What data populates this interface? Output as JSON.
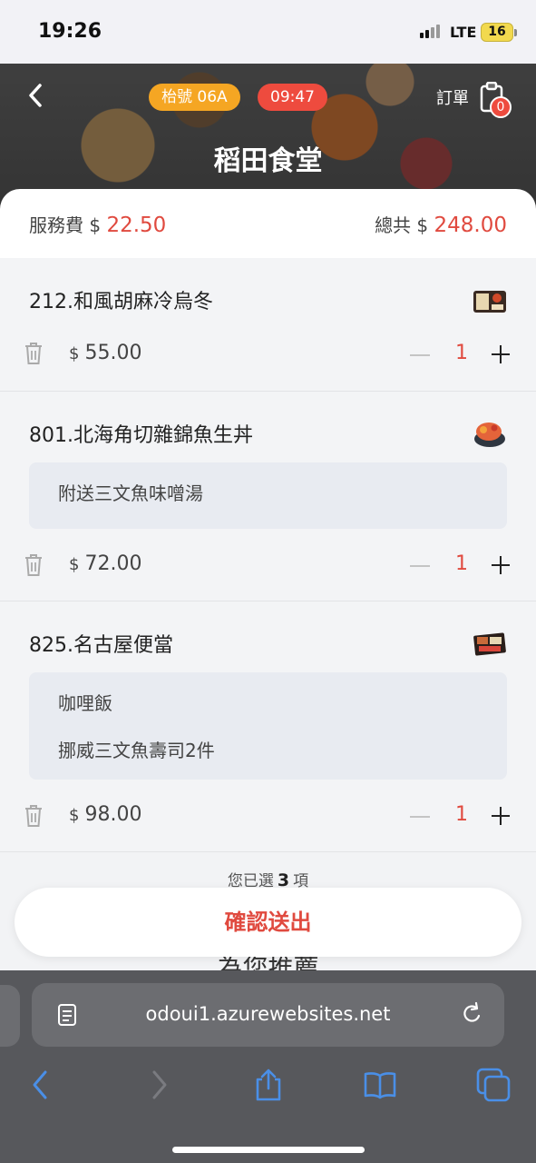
{
  "status_bar": {
    "time": "19:26",
    "network": "LTE",
    "battery": "16"
  },
  "header": {
    "table_chip": "枱號 06A",
    "timer_chip": "09:47",
    "order_label": "訂單",
    "order_count": "0",
    "shop_name": "稻田食堂"
  },
  "summary": {
    "fee_label": "服務費 $",
    "fee_value": "22.50",
    "total_label": "總共 $",
    "total_value": "248.00"
  },
  "items": [
    {
      "name": "212.和風胡麻冷烏冬",
      "options": [],
      "currency": "$",
      "price": "55.00",
      "qty": "1"
    },
    {
      "name": "801.北海角切雜錦魚生丼",
      "options": [
        "附送三文魚味噌湯"
      ],
      "currency": "$",
      "price": "72.00",
      "qty": "1"
    },
    {
      "name": "825.名古屋便當",
      "options": [
        "咖哩飯",
        "挪威三文魚壽司2件"
      ],
      "currency": "$",
      "price": "98.00",
      "qty": "1"
    }
  ],
  "footer": {
    "count_prefix": "您已選",
    "count_value": "3",
    "count_suffix": "項",
    "confirm_label": "確認送出",
    "partial_heading": "為您推薦"
  },
  "browser": {
    "url": "odoui1.azurewebsites.net"
  },
  "colors": {
    "accent": "#e04a3f",
    "table_chip": "#f5a623",
    "browser_icon": "#4a8fe7"
  }
}
